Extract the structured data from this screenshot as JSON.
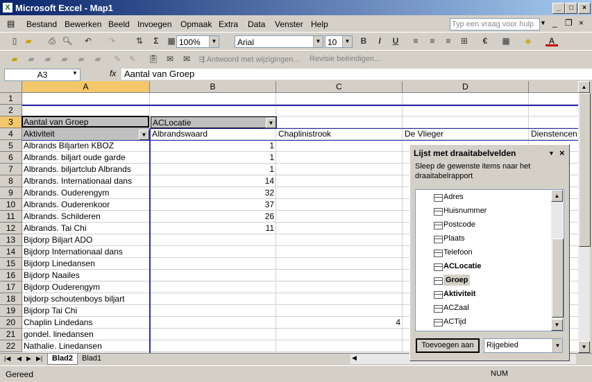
{
  "window": {
    "title": "Microsoft Excel - Map1",
    "app_icon": "excel-icon"
  },
  "menu": [
    "Bestand",
    "Bewerken",
    "Beeld",
    "Invoegen",
    "Opmaak",
    "Extra",
    "Data",
    "Venster",
    "Help"
  ],
  "help_box": {
    "placeholder": "Typ een vraag voor hulp"
  },
  "toolbar": {
    "zoom": "100%",
    "font": "Arial",
    "size": "10",
    "bold": "B",
    "italic": "I",
    "underline": "U",
    "euro": "€",
    "sigma": "Σ",
    "answer_label": "Antwoord met wijzigingen...",
    "end_review_label": "Revisie beëindigen..."
  },
  "formula_bar": {
    "name_box": "A3",
    "fx": "fx",
    "content": "Aantal van Groep"
  },
  "columns": [
    "A",
    "B",
    "C",
    "D"
  ],
  "rows": [
    "1",
    "2",
    "3",
    "4",
    "5",
    "6",
    "7",
    "8",
    "9",
    "10",
    "11",
    "12",
    "13",
    "14",
    "15",
    "16",
    "17",
    "18",
    "19",
    "20",
    "21",
    "22"
  ],
  "pivot": {
    "data_field": "Aantal van Groep",
    "column_field": "ACLocatie",
    "row_field": "Aktiviteit",
    "col_items": [
      "Albrandswaard",
      "Chaplinistrook",
      "De Vlieger",
      "Dienstencen"
    ],
    "rows": [
      {
        "label": "Albrands Biljarten KBOZ",
        "b": "1",
        "c": ""
      },
      {
        "label": "Albrands. biljart oude garde",
        "b": "1",
        "c": ""
      },
      {
        "label": "Albrands. biljartclub Albrands",
        "b": "1",
        "c": ""
      },
      {
        "label": "Albrands. Internationaal dans",
        "b": "14",
        "c": ""
      },
      {
        "label": "Albrands. Ouderengym",
        "b": "32",
        "c": ""
      },
      {
        "label": "Albrands. Ouderenkoor",
        "b": "37",
        "c": ""
      },
      {
        "label": "Albrands. Schilderen",
        "b": "26",
        "c": ""
      },
      {
        "label": "Albrands. Tai Chi",
        "b": "11",
        "c": ""
      },
      {
        "label": "Bijdorp Biljart ADO",
        "b": "",
        "c": ""
      },
      {
        "label": "Bijdorp Internationaal dans",
        "b": "",
        "c": ""
      },
      {
        "label": "Bijdorp Linedansen",
        "b": "",
        "c": ""
      },
      {
        "label": "Bijdorp Naailes",
        "b": "",
        "c": ""
      },
      {
        "label": "Bijdorp Ouderengym",
        "b": "",
        "c": ""
      },
      {
        "label": "bijdorp schoutenboys biljart",
        "b": "",
        "c": ""
      },
      {
        "label": "Bijdorp Tai Chi",
        "b": "",
        "c": ""
      },
      {
        "label": "Chaplin Lindedans",
        "b": "",
        "c": "4"
      },
      {
        "label": "gondel. linedansen",
        "b": "",
        "c": ""
      },
      {
        "label": "Nathalie. Linedansen",
        "b": "",
        "c": ""
      }
    ]
  },
  "field_pane": {
    "title": "Lijst met draaitabelvelden",
    "instructions": "Sleep de gewenste items naar het draaitabelrapport",
    "fields": [
      {
        "label": "Adres",
        "bold": false
      },
      {
        "label": "Huisnummer",
        "bold": false
      },
      {
        "label": "Postcode",
        "bold": false
      },
      {
        "label": "Plaats",
        "bold": false
      },
      {
        "label": "Telefoon",
        "bold": false
      },
      {
        "label": "ACLocatie",
        "bold": true
      },
      {
        "label": "Groep",
        "bold": true
      },
      {
        "label": "Aktiviteit",
        "bold": true
      },
      {
        "label": "ACZaal",
        "bold": false
      },
      {
        "label": "ACTijd",
        "bold": false
      }
    ],
    "add_button": "Toevoegen aan",
    "area_select": "Rijgebied"
  },
  "sheet_tabs": [
    "Blad2",
    "Blad1"
  ],
  "status": {
    "left": "Gereed",
    "num": "NUM"
  }
}
